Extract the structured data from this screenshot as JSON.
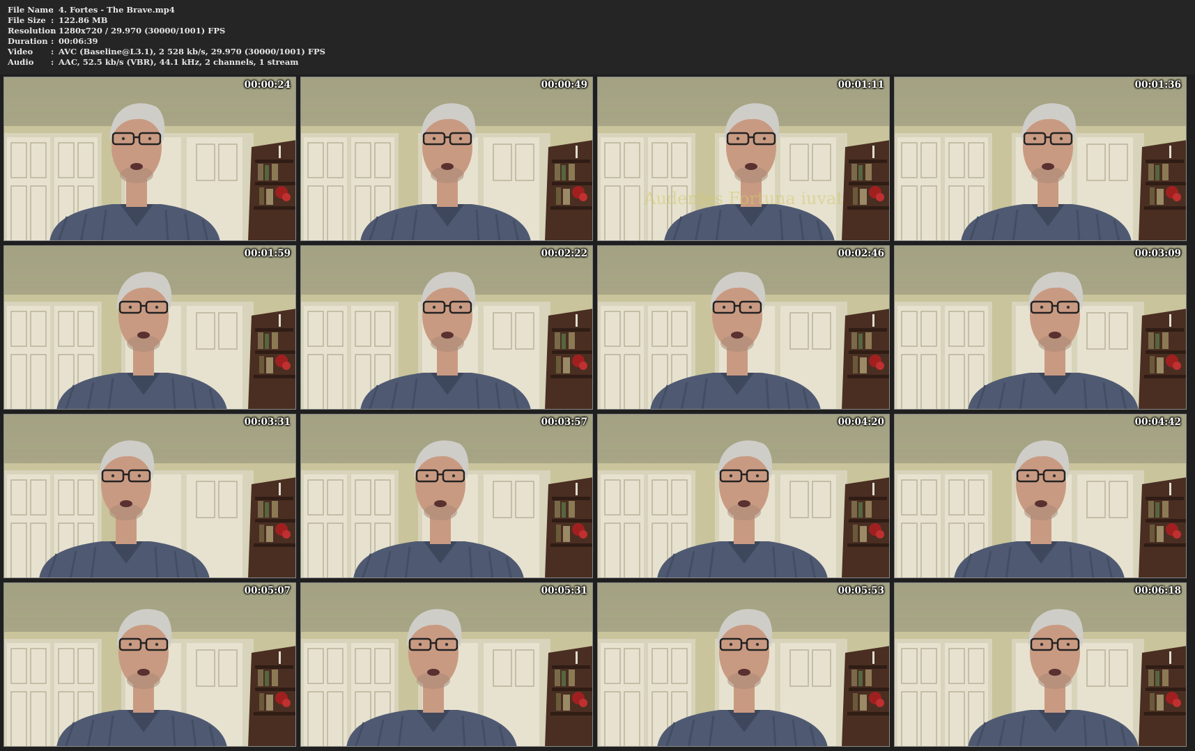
{
  "info": [
    {
      "label": "File Name",
      "value": "4. Fortes - The Brave.mp4"
    },
    {
      "label": "File Size",
      "value": "122.86 MB"
    },
    {
      "label": "Resolution",
      "value": "1280x720 / 29.970 (30000/1001) FPS"
    },
    {
      "label": "Duration",
      "value": "00:06:39"
    },
    {
      "label": "Video",
      "value": "AVC (Baseline@L3.1), 2 528 kb/s, 29.970 (30000/1001) FPS"
    },
    {
      "label": "Audio",
      "value": "AAC, 52.5 kb/s (VBR), 44.1 kHz, 2 channels, 1 stream"
    }
  ],
  "separator": ":",
  "watermark": "Audentes Fortuna iuvat",
  "thumbnails": [
    "00:00:24",
    "00:00:49",
    "00:01:11",
    "00:01:36",
    "00:01:59",
    "00:02:22",
    "00:02:46",
    "00:03:09",
    "00:03:31",
    "00:03:57",
    "00:04:20",
    "00:04:42",
    "00:05:07",
    "00:05:31",
    "00:05:53",
    "00:06:18"
  ],
  "colors": {
    "wall": "#c9c49b",
    "door": "#e7e2cf",
    "shirt": "#4f5a72",
    "skin": "#c99a82",
    "hair": "#cfcdc8",
    "shelf": "#4a2e22"
  }
}
